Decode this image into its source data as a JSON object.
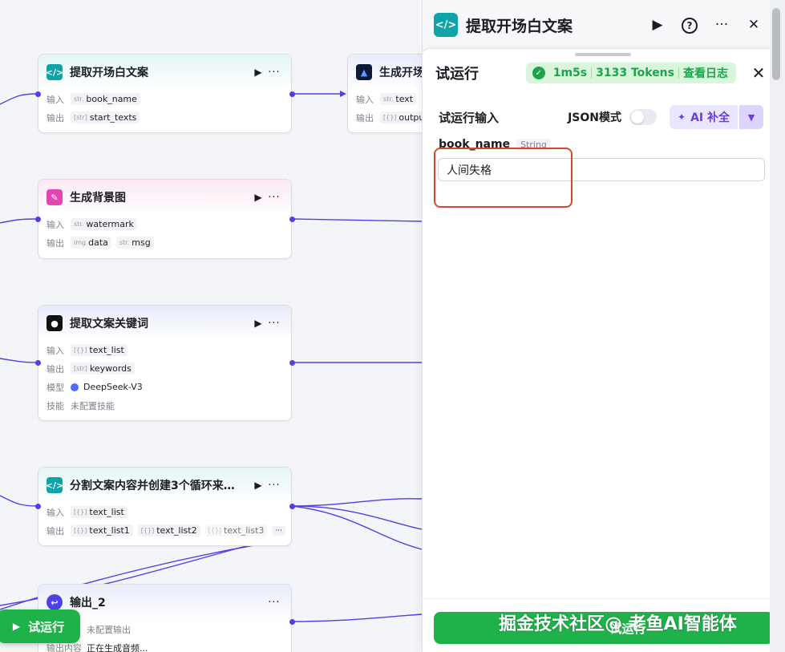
{
  "canvas": {
    "nodes": [
      {
        "title": "提取开场白文案",
        "in_label": "输入",
        "in_type": "str.",
        "in_value": "book_name",
        "out_label": "输出",
        "out_type": "[str]",
        "out_value": "start_texts"
      },
      {
        "title": "生成开场",
        "in_label": "输入",
        "in_type": "str.",
        "in_value": "text",
        "out_label": "输出",
        "out_type": "[{}]",
        "out_value": "output"
      },
      {
        "title": "生成背景图",
        "in_label": "输入",
        "in_type": "str.",
        "in_value": "watermark",
        "out_label": "输出",
        "out_type": "img",
        "out_value": "data",
        "out_type2": "str.",
        "out_value2": "msg"
      },
      {
        "title": "提取文案关键词",
        "in_label": "输入",
        "in_type": "[{}]",
        "in_value": "text_list",
        "out_label": "输出",
        "out_type": "[str]",
        "out_value": "keywords",
        "model_label": "模型",
        "model_value": "DeepSeek-V3",
        "skill_label": "技能",
        "skill_value": "未配置技能"
      },
      {
        "title": "分割文案内容并创建3个循环来…",
        "in_label": "输入",
        "in_type": "[{}]",
        "in_value": "text_list",
        "out_label": "输出",
        "out_values": [
          "text_list1",
          "text_list2",
          "text_list3"
        ],
        "out_type": "[{}]",
        "more": "···"
      },
      {
        "title": "输出_2",
        "row1": "未配置输出",
        "row2_label": "输出内容",
        "row2_value": "正在生成音频..."
      }
    ],
    "run_button": "试运行"
  },
  "panel": {
    "title": "提取开场白文案",
    "test": {
      "title": "试运行",
      "status_time": "1m5s",
      "status_tokens": "3133 Tokens",
      "status_log": "查看日志",
      "input_title": "试运行输入",
      "json_mode": "JSON模式",
      "ai_button": "AI 补全",
      "field_name": "book_name",
      "field_type": "String",
      "field_value": "人间失格",
      "run_label": "试运行"
    }
  },
  "watermark": "掘金技术社区@ 老鱼AI智能体",
  "colors": {
    "accent": "#4e40e5",
    "success": "#1fb24a",
    "teal": "#10a4a8",
    "ai": "#6b3ddb"
  }
}
